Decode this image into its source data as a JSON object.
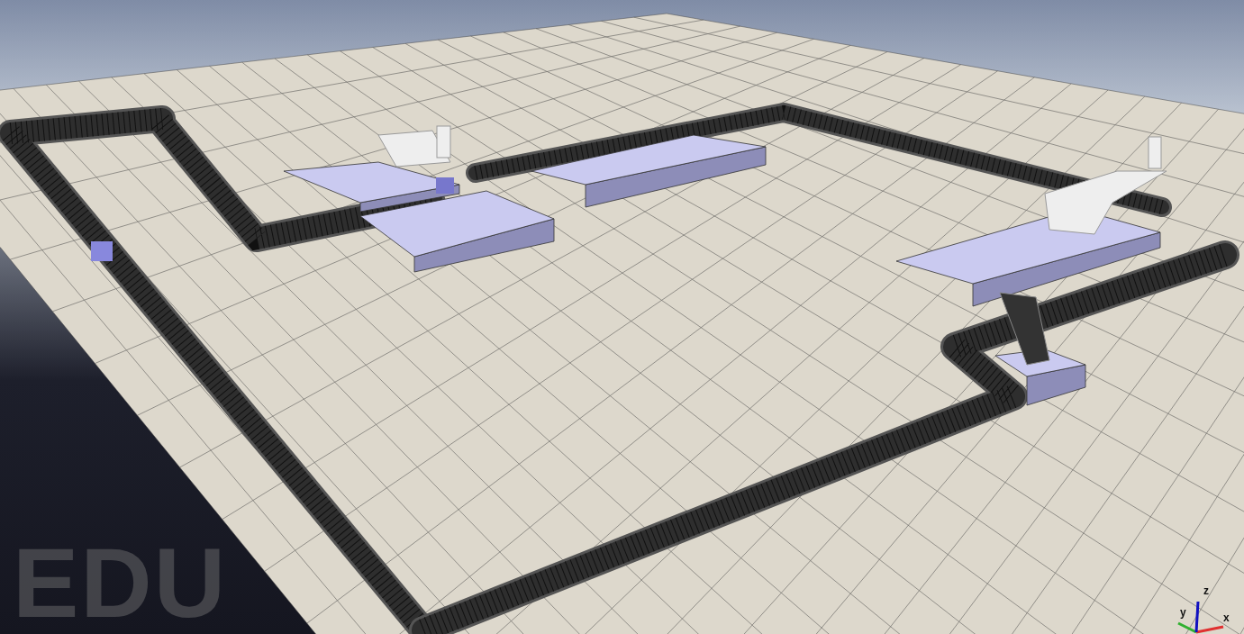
{
  "viewport": {
    "watermark": "EDU",
    "axes": [
      {
        "label": "x",
        "color": "#e03030"
      },
      {
        "label": "y",
        "color": "#30b030"
      },
      {
        "label": "z",
        "color": "#1010c0"
      }
    ]
  }
}
